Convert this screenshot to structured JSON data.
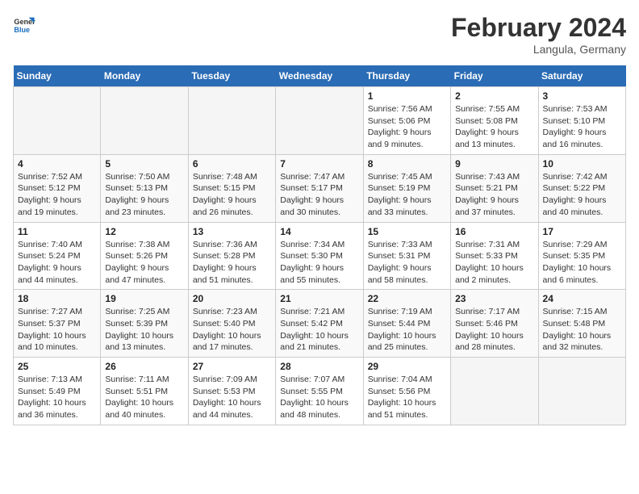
{
  "header": {
    "logo_general": "General",
    "logo_blue": "Blue",
    "title": "February 2024",
    "subtitle": "Langula, Germany"
  },
  "days_of_week": [
    "Sunday",
    "Monday",
    "Tuesday",
    "Wednesday",
    "Thursday",
    "Friday",
    "Saturday"
  ],
  "weeks": [
    [
      {
        "day": "",
        "info": ""
      },
      {
        "day": "",
        "info": ""
      },
      {
        "day": "",
        "info": ""
      },
      {
        "day": "",
        "info": ""
      },
      {
        "day": "1",
        "info": "Sunrise: 7:56 AM\nSunset: 5:06 PM\nDaylight: 9 hours and 9 minutes."
      },
      {
        "day": "2",
        "info": "Sunrise: 7:55 AM\nSunset: 5:08 PM\nDaylight: 9 hours and 13 minutes."
      },
      {
        "day": "3",
        "info": "Sunrise: 7:53 AM\nSunset: 5:10 PM\nDaylight: 9 hours and 16 minutes."
      }
    ],
    [
      {
        "day": "4",
        "info": "Sunrise: 7:52 AM\nSunset: 5:12 PM\nDaylight: 9 hours and 19 minutes."
      },
      {
        "day": "5",
        "info": "Sunrise: 7:50 AM\nSunset: 5:13 PM\nDaylight: 9 hours and 23 minutes."
      },
      {
        "day": "6",
        "info": "Sunrise: 7:48 AM\nSunset: 5:15 PM\nDaylight: 9 hours and 26 minutes."
      },
      {
        "day": "7",
        "info": "Sunrise: 7:47 AM\nSunset: 5:17 PM\nDaylight: 9 hours and 30 minutes."
      },
      {
        "day": "8",
        "info": "Sunrise: 7:45 AM\nSunset: 5:19 PM\nDaylight: 9 hours and 33 minutes."
      },
      {
        "day": "9",
        "info": "Sunrise: 7:43 AM\nSunset: 5:21 PM\nDaylight: 9 hours and 37 minutes."
      },
      {
        "day": "10",
        "info": "Sunrise: 7:42 AM\nSunset: 5:22 PM\nDaylight: 9 hours and 40 minutes."
      }
    ],
    [
      {
        "day": "11",
        "info": "Sunrise: 7:40 AM\nSunset: 5:24 PM\nDaylight: 9 hours and 44 minutes."
      },
      {
        "day": "12",
        "info": "Sunrise: 7:38 AM\nSunset: 5:26 PM\nDaylight: 9 hours and 47 minutes."
      },
      {
        "day": "13",
        "info": "Sunrise: 7:36 AM\nSunset: 5:28 PM\nDaylight: 9 hours and 51 minutes."
      },
      {
        "day": "14",
        "info": "Sunrise: 7:34 AM\nSunset: 5:30 PM\nDaylight: 9 hours and 55 minutes."
      },
      {
        "day": "15",
        "info": "Sunrise: 7:33 AM\nSunset: 5:31 PM\nDaylight: 9 hours and 58 minutes."
      },
      {
        "day": "16",
        "info": "Sunrise: 7:31 AM\nSunset: 5:33 PM\nDaylight: 10 hours and 2 minutes."
      },
      {
        "day": "17",
        "info": "Sunrise: 7:29 AM\nSunset: 5:35 PM\nDaylight: 10 hours and 6 minutes."
      }
    ],
    [
      {
        "day": "18",
        "info": "Sunrise: 7:27 AM\nSunset: 5:37 PM\nDaylight: 10 hours and 10 minutes."
      },
      {
        "day": "19",
        "info": "Sunrise: 7:25 AM\nSunset: 5:39 PM\nDaylight: 10 hours and 13 minutes."
      },
      {
        "day": "20",
        "info": "Sunrise: 7:23 AM\nSunset: 5:40 PM\nDaylight: 10 hours and 17 minutes."
      },
      {
        "day": "21",
        "info": "Sunrise: 7:21 AM\nSunset: 5:42 PM\nDaylight: 10 hours and 21 minutes."
      },
      {
        "day": "22",
        "info": "Sunrise: 7:19 AM\nSunset: 5:44 PM\nDaylight: 10 hours and 25 minutes."
      },
      {
        "day": "23",
        "info": "Sunrise: 7:17 AM\nSunset: 5:46 PM\nDaylight: 10 hours and 28 minutes."
      },
      {
        "day": "24",
        "info": "Sunrise: 7:15 AM\nSunset: 5:48 PM\nDaylight: 10 hours and 32 minutes."
      }
    ],
    [
      {
        "day": "25",
        "info": "Sunrise: 7:13 AM\nSunset: 5:49 PM\nDaylight: 10 hours and 36 minutes."
      },
      {
        "day": "26",
        "info": "Sunrise: 7:11 AM\nSunset: 5:51 PM\nDaylight: 10 hours and 40 minutes."
      },
      {
        "day": "27",
        "info": "Sunrise: 7:09 AM\nSunset: 5:53 PM\nDaylight: 10 hours and 44 minutes."
      },
      {
        "day": "28",
        "info": "Sunrise: 7:07 AM\nSunset: 5:55 PM\nDaylight: 10 hours and 48 minutes."
      },
      {
        "day": "29",
        "info": "Sunrise: 7:04 AM\nSunset: 5:56 PM\nDaylight: 10 hours and 51 minutes."
      },
      {
        "day": "",
        "info": ""
      },
      {
        "day": "",
        "info": ""
      }
    ]
  ]
}
